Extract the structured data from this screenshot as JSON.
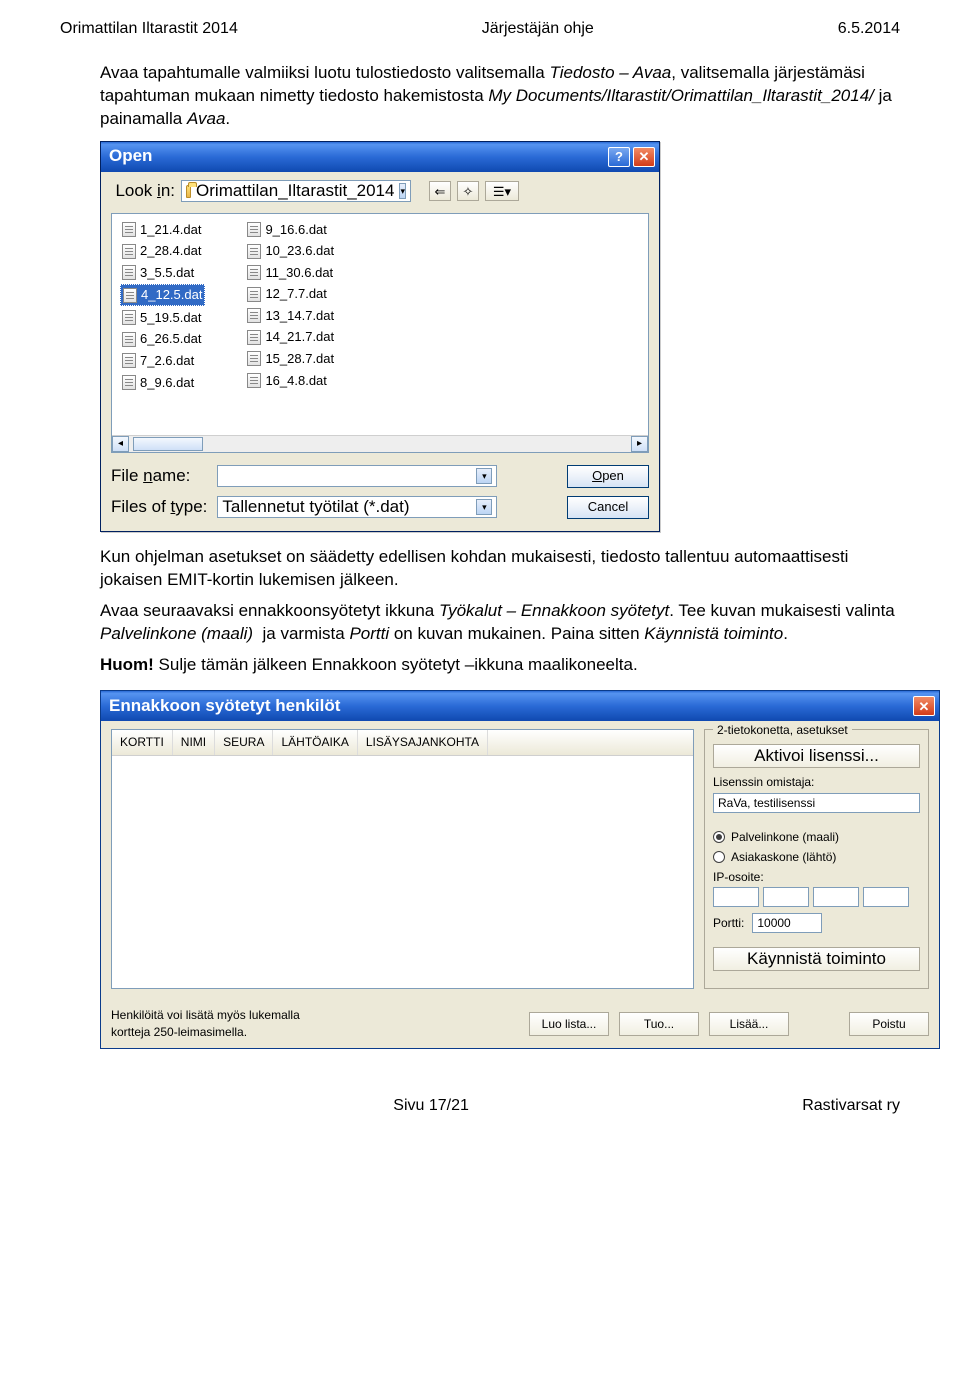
{
  "header": {
    "left": "Orimattilan Iltarastit 2014",
    "center": "Järjestäjän ohje",
    "right": "6.5.2014"
  },
  "intro_html": "Avaa tapahtumalle valmiiksi luotu tulostiedosto valitsemalla Tiedosto – Avaa, valitsemalla järjestämäsi tapahtuman mukaan nimetty tiedosto hakemistosta My Documents/Iltarastit/Orimattilan_Iltarastit_2014/ ja painamalla Avaa.",
  "openDialog": {
    "title": "Open",
    "lookin_label": "Look in:",
    "lookin_value": "Orimattilan_Iltarastit_2014",
    "files_left": [
      "1_21.4.dat",
      "2_28.4.dat",
      "3_5.5.dat",
      "4_12.5.dat",
      "5_19.5.dat",
      "6_26.5.dat",
      "7_2.6.dat",
      "8_9.6.dat"
    ],
    "files_right": [
      "9_16.6.dat",
      "10_23.6.dat",
      "11_30.6.dat",
      "12_7.7.dat",
      "13_14.7.dat",
      "14_21.7.dat",
      "15_28.7.dat",
      "16_4.8.dat"
    ],
    "selected": "4_12.5.dat",
    "filename_label": "File name:",
    "filename_value": "",
    "filetype_label": "Files of type:",
    "filetype_value": "Tallennetut työtilat (*.dat)",
    "open_btn": "Open",
    "cancel_btn": "Cancel"
  },
  "text_after": [
    "Kun ohjelman asetukset on säädetty edellisen kohdan mukaisesti, tiedosto tallentuu automaattisesti jokaisen EMIT-kortin lukemisen jälkeen.",
    "Avaa seuraavaksi ennakkoonsyötetyt ikkuna Työkalut – Ennakkoon syötetyt. Tee kuvan mukaisesti valinta Palvelinkone (maali)  ja varmista Portti on kuvan mukainen. Paina sitten Käynnistä toiminto.",
    "Huom! Sulje tämän jälkeen Ennakkoon syötetyt –ikkuna maalikoneelta."
  ],
  "huom_label": "Huom!",
  "ennakkoon": {
    "title": "Ennakkoon syötetyt henkilöt",
    "columns": [
      "KORTTI",
      "NIMI",
      "SEURA",
      "LÄHTÖAIKA",
      "LISÄYSAJANKOHTA"
    ],
    "side_title": "2-tietokonetta, asetukset",
    "activate": "Aktivoi lisenssi...",
    "lisenssi_label": "Lisenssin omistaja:",
    "lisenssi_value": "RaVa, testilisenssi",
    "radio_server": "Palvelinkone (maali)",
    "radio_client": "Asiakaskone (lähtö)",
    "ip_label": "IP-osoite:",
    "port_label": "Portti:",
    "port_value": "10000",
    "start": "Käynnistä toiminto",
    "footer_text": "Henkilöitä voi lisätä myös lukemalla kortteja 250-leimasimella.",
    "btn_luo": "Luo lista...",
    "btn_tuo": "Tuo...",
    "btn_lisaa": "Lisää...",
    "btn_poistu": "Poistu"
  },
  "footer": {
    "center": "Sivu 17/21",
    "right": "Rastivarsat ry"
  }
}
